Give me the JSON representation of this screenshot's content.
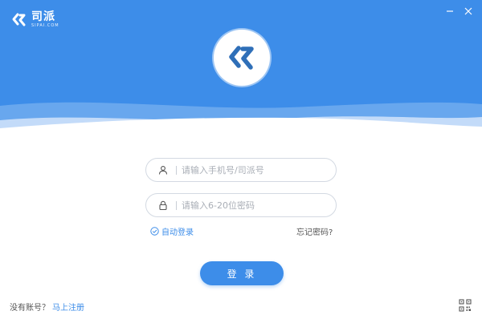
{
  "brand": {
    "name": "司派",
    "subtitle": "SIPAI.COM",
    "accent_color": "#3d8de9"
  },
  "window_controls": {
    "minimize_icon": "minimize-icon",
    "close_icon": "close-icon"
  },
  "login_form": {
    "account_placeholder": "请输入手机号/司派号",
    "account_icon": "user-icon",
    "password_placeholder": "请输入6-20位密码",
    "password_icon": "lock-icon",
    "auto_login_label": "自动登录",
    "auto_login_checked": true,
    "forgot_password_label": "忘记密码?",
    "login_button_label": "登 录"
  },
  "footer": {
    "no_account_text": "没有账号？",
    "register_link": "马上注册",
    "qr_icon": "qr-code-icon"
  }
}
